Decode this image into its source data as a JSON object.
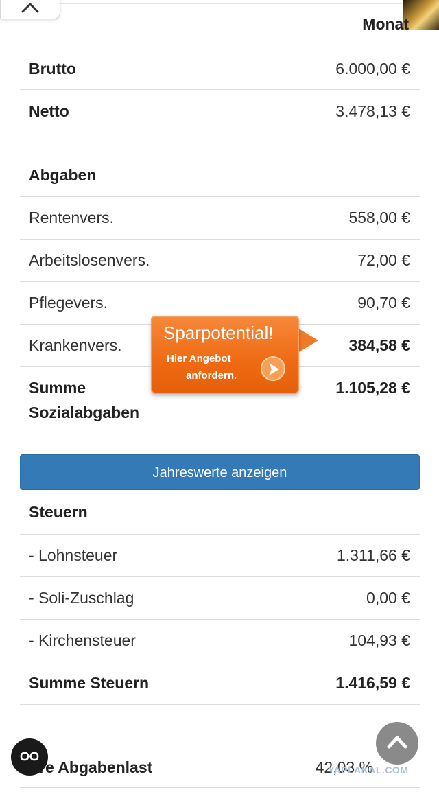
{
  "header": {
    "column_label": "Monat"
  },
  "summary": [
    {
      "label": "Brutto",
      "value": "6.000,00 €"
    },
    {
      "label": "Netto",
      "value": "3.478,13 €"
    }
  ],
  "abgaben": {
    "title": "Abgaben",
    "items": [
      {
        "label": "Rentenvers.",
        "value": "558,00 €"
      },
      {
        "label": "Arbeitslosenvers.",
        "value": "72,00 €"
      },
      {
        "label": "Pflegevers.",
        "value": "90,70 €"
      },
      {
        "label": "Krankenvers.",
        "value": "384,58 €"
      }
    ],
    "total_label_line1": "Summe",
    "total_label_line2": "Sozialabgaben",
    "total_value": "1.105,28 €"
  },
  "promo": {
    "title": "Sparpotential!",
    "line1": "Hier Angebot",
    "line2": "anfordern."
  },
  "toggle_button": {
    "label": "Jahreswerte anzeigen"
  },
  "steuern": {
    "title": "Steuern",
    "items": [
      {
        "label": "- Lohnsteuer",
        "value": "1.311,66 €"
      },
      {
        "label": "- Soli-Zuschlag",
        "value": "0,00 €"
      },
      {
        "label": "- Kirchensteuer",
        "value": "104,93 €"
      }
    ],
    "total_label": "Summe Steuern",
    "total_value": "1.416,59 €"
  },
  "abgabenlast": {
    "label": "re Abgabenlast",
    "value": "42,03 %"
  },
  "watermark": "YAPLAKAL.COM",
  "icons": {
    "collapse": "chevron-up-icon",
    "reader": "glasses-icon",
    "scroll_top": "chevron-up-icon",
    "promo_go": "arrow-right-icon"
  },
  "colors": {
    "primary_button": "#337ab7",
    "promo_orange": "#ee6a12"
  }
}
